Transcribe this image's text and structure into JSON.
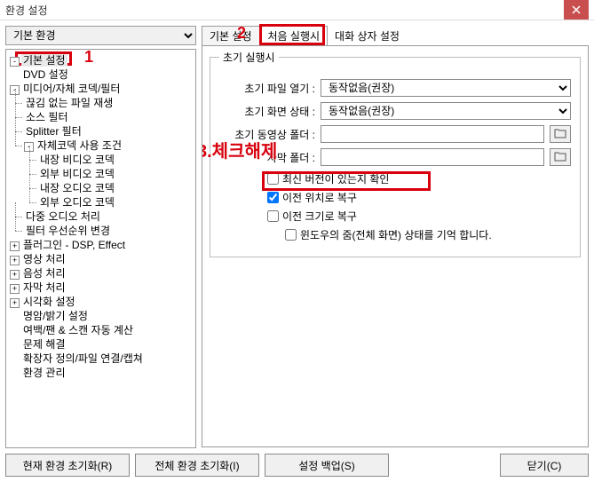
{
  "window": {
    "title": "환경 설정"
  },
  "preset": {
    "selected": "기본 환경"
  },
  "tree": {
    "n0": "기본 설정",
    "n1": "DVD 설정",
    "n2": "미디어/자체 코덱/필터",
    "n2_0": "끊김 없는 파일 재생",
    "n2_1": "소스 필터",
    "n2_2": "Splitter 필터",
    "n2_3": "자체코덱 사용 조건",
    "n2_3_0": "내장 비디오 코덱",
    "n2_3_1": "외부 비디오 코덱",
    "n2_3_2": "내장 오디오 코덱",
    "n2_3_3": "외부 오디오 코덱",
    "n2_4": "다중 오디오 처리",
    "n2_5": "필터 우선순위 변경",
    "n3": "플러그인 - DSP, Effect",
    "n4": "영상 처리",
    "n5": "음성 처리",
    "n6": "자막 처리",
    "n7": "시각화 설정",
    "n8": "명암/밝기 설정",
    "n9": "여백/팬 & 스캔 자동 계산",
    "n10": "문제 해결",
    "n11": "확장자 정의/파일 연결/캡쳐",
    "n12": "환경 관리"
  },
  "tabs": {
    "t0": "기본 설정",
    "t1": "처음 실행시",
    "t2": "대화 상자 설정"
  },
  "fieldset": {
    "legend": "초기 실행시"
  },
  "labels": {
    "file_open": "초기 파일 열기 :",
    "screen_state": "초기 화면 상태 :",
    "video_folder": "초기 동영상 폴더 :",
    "subtitle_folder": "자막 폴더 :"
  },
  "selects": {
    "file_open": "동작없음(권장)",
    "screen_state": "동작없음(권장)"
  },
  "opts": {
    "check_update": "최신 버전이 있는지 확인",
    "restore_pos": "이전 위치로 복구",
    "restore_size": "이전 크기로 복구",
    "remember_zoom": "윈도우의 줌(전체 화면) 상태를 기억 합니다."
  },
  "buttons": {
    "reset_current": "현재 환경 초기화(R)",
    "reset_all": "전체 환경 초기화(I)",
    "backup": "설정 백업(S)",
    "close": "닫기(C)"
  },
  "annotations": {
    "a1": "1",
    "a2": "2",
    "a3": "3.체크해제"
  }
}
